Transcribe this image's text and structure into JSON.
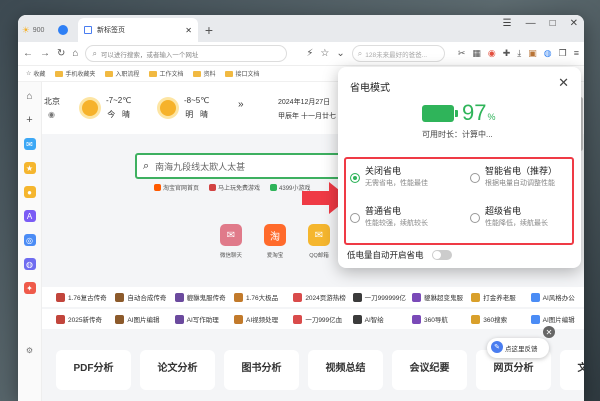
{
  "tabbar": {
    "mini_tab_count": "900",
    "active_tab_title": "新标签页",
    "new_tab_glyph": "+",
    "window_controls": [
      "☰",
      "—",
      "□",
      "✕"
    ]
  },
  "addressbar": {
    "back": "←",
    "forward": "→",
    "reload": "↻",
    "home": "⌂",
    "url_placeholder": "可以进行搜索，或者输入一个网址",
    "search_placeholder": "128未来最好的爸爸..."
  },
  "bookmarks": {
    "items": [
      "收藏",
      "手机收藏夹",
      "入职流程",
      "工作文档",
      "资料",
      "接口文档"
    ],
    "right_label": "设置"
  },
  "weather": {
    "city": "北京",
    "day1": {
      "temp": "-7~2℃",
      "cond": "今",
      "cond2": "晴"
    },
    "day2": {
      "temp": "-8~5℃",
      "cond": "明",
      "cond2": "晴"
    },
    "date_line1": "2024年12月27日",
    "date_line2": "甲辰年 十一月廿七"
  },
  "search": {
    "query": "南海九段线太欺人太甚"
  },
  "hotlinks": [
    "淘宝官网首页",
    "马上玩免费游戏",
    "4399小游戏"
  ],
  "apps": [
    {
      "label": "微信聊天",
      "glyph": "✉",
      "color": "#e07a8a"
    },
    {
      "label": "爱淘宝",
      "glyph": "淘",
      "color": "#ff6a2b"
    },
    {
      "label": "QQ邮箱",
      "glyph": "✉",
      "color": "#f5b62e"
    }
  ],
  "games_row1": [
    "1.76复古传奇",
    "自动合成传奇",
    "貔貅鬼服传奇",
    "1.76大极品",
    "2024页游热榜",
    "一刀999999亿",
    "貔貅超变鬼服",
    "打金养老服",
    "AI风格办公"
  ],
  "games_row2": [
    "2025新传奇",
    "AI图片编辑",
    "AI写作助理",
    "AI视频处理",
    "一刀999亿血",
    "AI智绘",
    "360导航",
    "360搜索",
    "AI图片编辑"
  ],
  "cards": [
    "PDF分析",
    "论文分析",
    "图书分析",
    "视频总结",
    "会议纪要",
    "网页分析",
    "文档处理"
  ],
  "popup": {
    "title": "省电模式",
    "close": "✕",
    "percent": "97",
    "percent_unit": "%",
    "remaining": "可用时长：计算中...",
    "modes": [
      {
        "name": "关闭省电",
        "desc": "无需省电，性能最佳",
        "selected": true
      },
      {
        "name": "智能省电（推荐）",
        "desc": "根据电量自动调整性能",
        "selected": false
      },
      {
        "name": "普通省电",
        "desc": "性能较强，续航较长",
        "selected": false
      },
      {
        "name": "超级省电",
        "desc": "性能降低，续航最长",
        "selected": false
      }
    ],
    "auto_label": "低电量自动开启省电",
    "auto_enabled": false
  },
  "feedback": {
    "label": "点这里反馈",
    "close": "✕"
  },
  "colors": {
    "accent_green": "#2fb45a",
    "highlight_red": "#ef3a45",
    "search_border": "#3eb060"
  }
}
